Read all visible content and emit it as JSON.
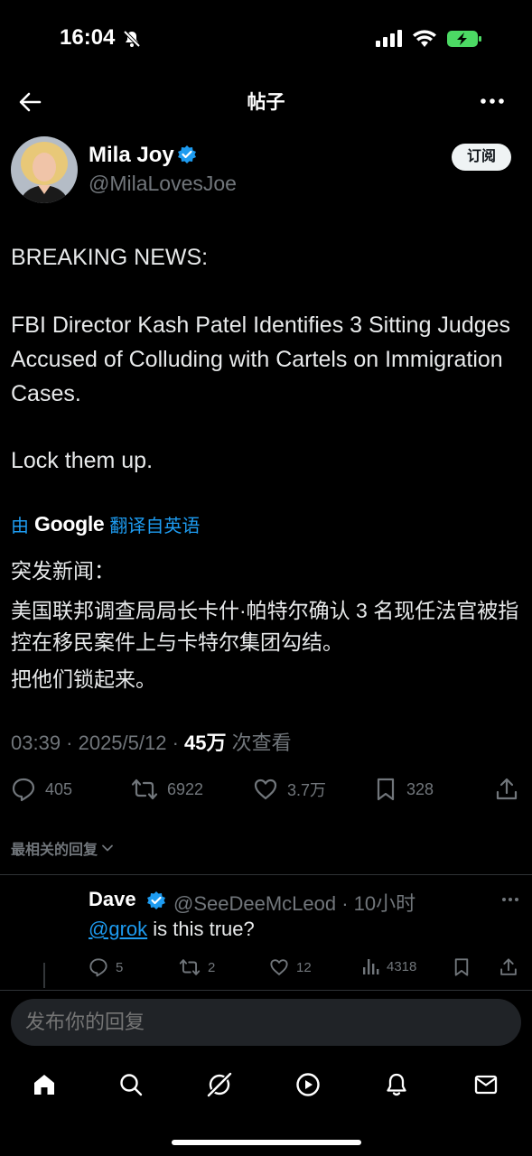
{
  "status_bar": {
    "time": "16:04"
  },
  "header": {
    "title": "帖子"
  },
  "author": {
    "name": "Mila Joy",
    "handle": "@MilaLovesJoe",
    "subscribe_label": "订阅"
  },
  "post": {
    "breaking": "BREAKING NEWS:",
    "body": "FBI Director Kash Patel Identifies 3 Sitting Judges Accused of Colluding with Cartels on Immigration Cases.",
    "closing": "Lock them up.",
    "translation": {
      "prefix": "由",
      "provider": "Google",
      "suffix": "翻译自英语",
      "line1": "突发新闻：",
      "line2": "美国联邦调查局局长卡什·帕特尔确认 3 名现任法官被指控在移民案件上与卡特尔集团勾结。",
      "line3": "把他们锁起来。"
    },
    "meta": {
      "time_date": "03:39 · 2025/5/12 · ",
      "views": "45万",
      "views_label": " 次查看"
    },
    "actions": {
      "replies": "405",
      "retweets": "6922",
      "likes": "3.7万",
      "bookmarks": "328"
    }
  },
  "replies_sort": {
    "label": "最相关的回复"
  },
  "reply": {
    "name": "Dave",
    "handle_time": "@SeeDeeMcLeod · 10小时",
    "mention": "@grok",
    "text": " is this true?",
    "actions": {
      "replies": "5",
      "retweets": "2",
      "likes": "12",
      "views": "4318"
    }
  },
  "composer": {
    "placeholder": "发布你的回复"
  },
  "colors": {
    "background": "#000000",
    "text": "#e7e9ea",
    "secondary": "#71767b",
    "accent": "#1d9bf0",
    "verified": "#1d9bf0",
    "battery": "#4cd964"
  },
  "icons": {
    "status": [
      "bell-slash-icon",
      "signal-icon",
      "wifi-icon",
      "battery-charging-icon"
    ],
    "nav": [
      "home-icon",
      "search-icon",
      "grok-icon",
      "play-icon",
      "bell-icon",
      "mail-icon"
    ]
  }
}
